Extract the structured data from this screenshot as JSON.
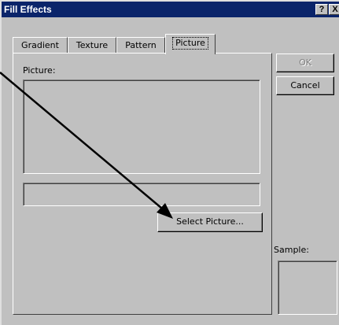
{
  "window": {
    "title": "Fill Effects",
    "help_button": "?",
    "close_button": "X"
  },
  "tabs": [
    {
      "label": "Gradient",
      "active": false
    },
    {
      "label": "Texture",
      "active": false
    },
    {
      "label": "Pattern",
      "active": false
    },
    {
      "label": "Picture",
      "active": true
    }
  ],
  "picture_panel": {
    "picture_label": "Picture:",
    "filename_value": "",
    "select_button_label": "Select Picture..."
  },
  "buttons": {
    "ok_label": "OK",
    "ok_enabled": false,
    "cancel_label": "Cancel"
  },
  "sample": {
    "label": "Sample:"
  },
  "annotation": {
    "icon": "arrow-icon",
    "color": "#000000"
  }
}
